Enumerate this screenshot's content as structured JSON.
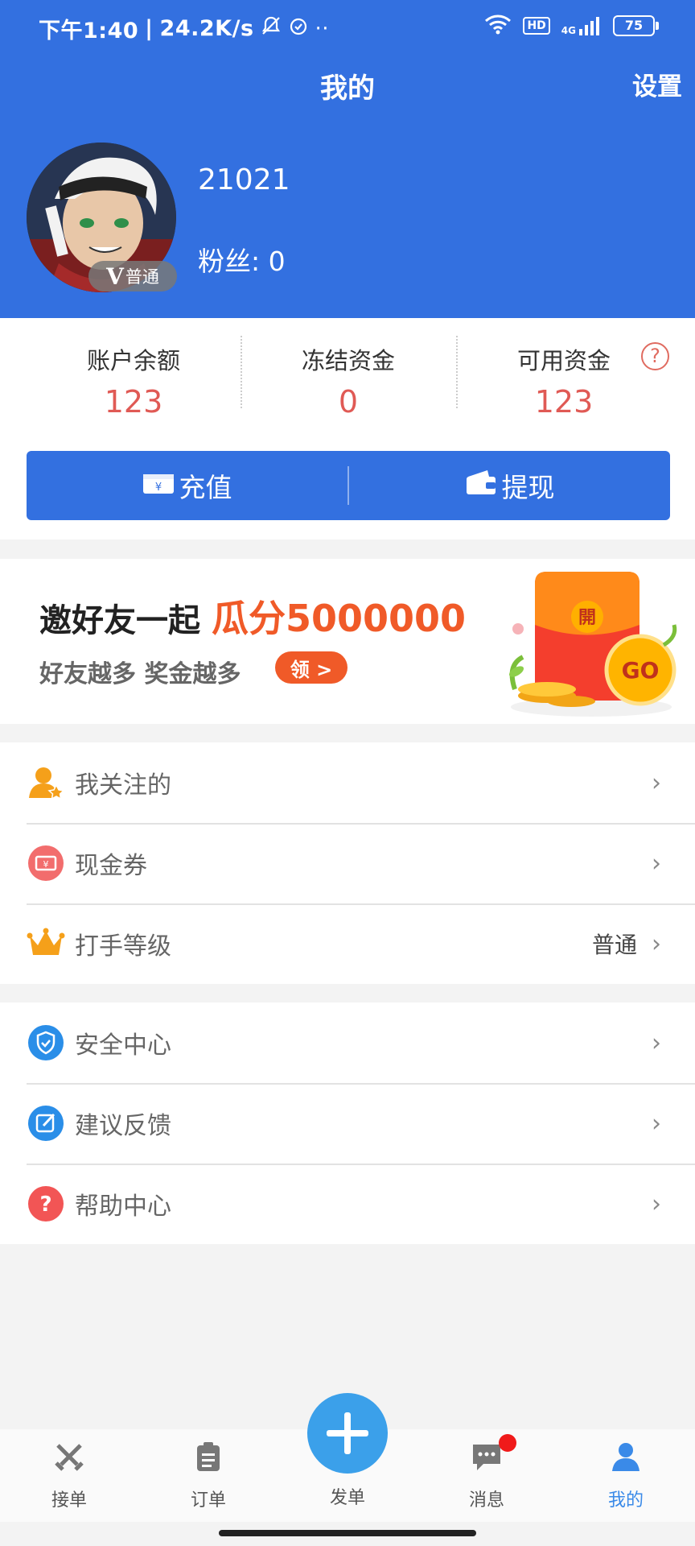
{
  "status_bar": {
    "time": "下午1:40",
    "speed": "24.2K/s",
    "network": "4G",
    "hd": "HD",
    "battery": "75"
  },
  "header": {
    "title": "我的",
    "settings": "设置"
  },
  "profile": {
    "username": "21021",
    "fans_label": "粉丝: 0",
    "badge_v": "V",
    "badge_level": "普通"
  },
  "balance": {
    "items": [
      {
        "label": "账户余额",
        "value": "123"
      },
      {
        "label": "冻结资金",
        "value": "0"
      },
      {
        "label": "可用资金",
        "value": "123"
      }
    ],
    "help": "?",
    "recharge": "充值",
    "withdraw": "提现"
  },
  "banner": {
    "title_prefix": "邀好友一起",
    "title_highlight": "瓜分5000000",
    "subtitle": "好友越多  奖金越多",
    "pill": "领 >",
    "envelope_text": "開",
    "coin_text": "GO"
  },
  "menu_group_1": [
    {
      "label": "我关注的",
      "icon": "user-star-icon"
    },
    {
      "label": "现金券",
      "icon": "coupon-icon"
    },
    {
      "label": "打手等级",
      "icon": "crown-icon",
      "value": "普通"
    }
  ],
  "menu_group_2": [
    {
      "label": "安全中心",
      "icon": "shield-icon"
    },
    {
      "label": "建议反馈",
      "icon": "edit-icon"
    },
    {
      "label": "帮助中心",
      "icon": "question-icon"
    }
  ],
  "tabbar": {
    "tabs": [
      {
        "label": "接单",
        "icon": "swords-icon"
      },
      {
        "label": "订单",
        "icon": "clipboard-icon"
      },
      {
        "label": "发单",
        "icon": "plus-icon"
      },
      {
        "label": "消息",
        "icon": "chat-icon"
      },
      {
        "label": "我的",
        "icon": "person-icon"
      }
    ],
    "active": "我的"
  },
  "colors": {
    "brand_blue": "#3370e0",
    "amount_red": "#e05a55",
    "banner_orange": "#f05a28",
    "active_tab": "#3a8ae8"
  }
}
